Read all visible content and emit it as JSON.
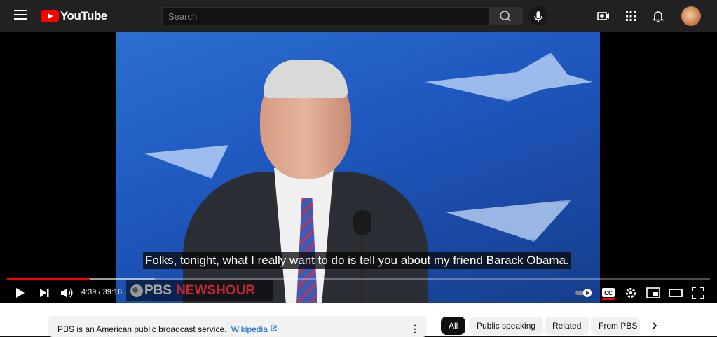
{
  "header": {
    "logo_text": "YouTube",
    "search_placeholder": "Search"
  },
  "video": {
    "caption": "Folks, tonight, what I really want to do is tell you about my friend Barack Obama.",
    "watermark_pbs": "PBS",
    "watermark_newshour": "NEWSHOUR"
  },
  "player": {
    "time": "4:39 / 39:16",
    "played_fraction": 0.118,
    "loaded_fraction": 0.21
  },
  "info_panel": {
    "text": "PBS is an American public broadcast service.",
    "link": "Wikipedia"
  },
  "chips": {
    "all": "All",
    "public_speaking": "Public speaking",
    "related": "Related",
    "from_pbs": "From PBS"
  },
  "colors": {
    "brand_red": "#ff0000",
    "link_blue": "#065fd4"
  }
}
